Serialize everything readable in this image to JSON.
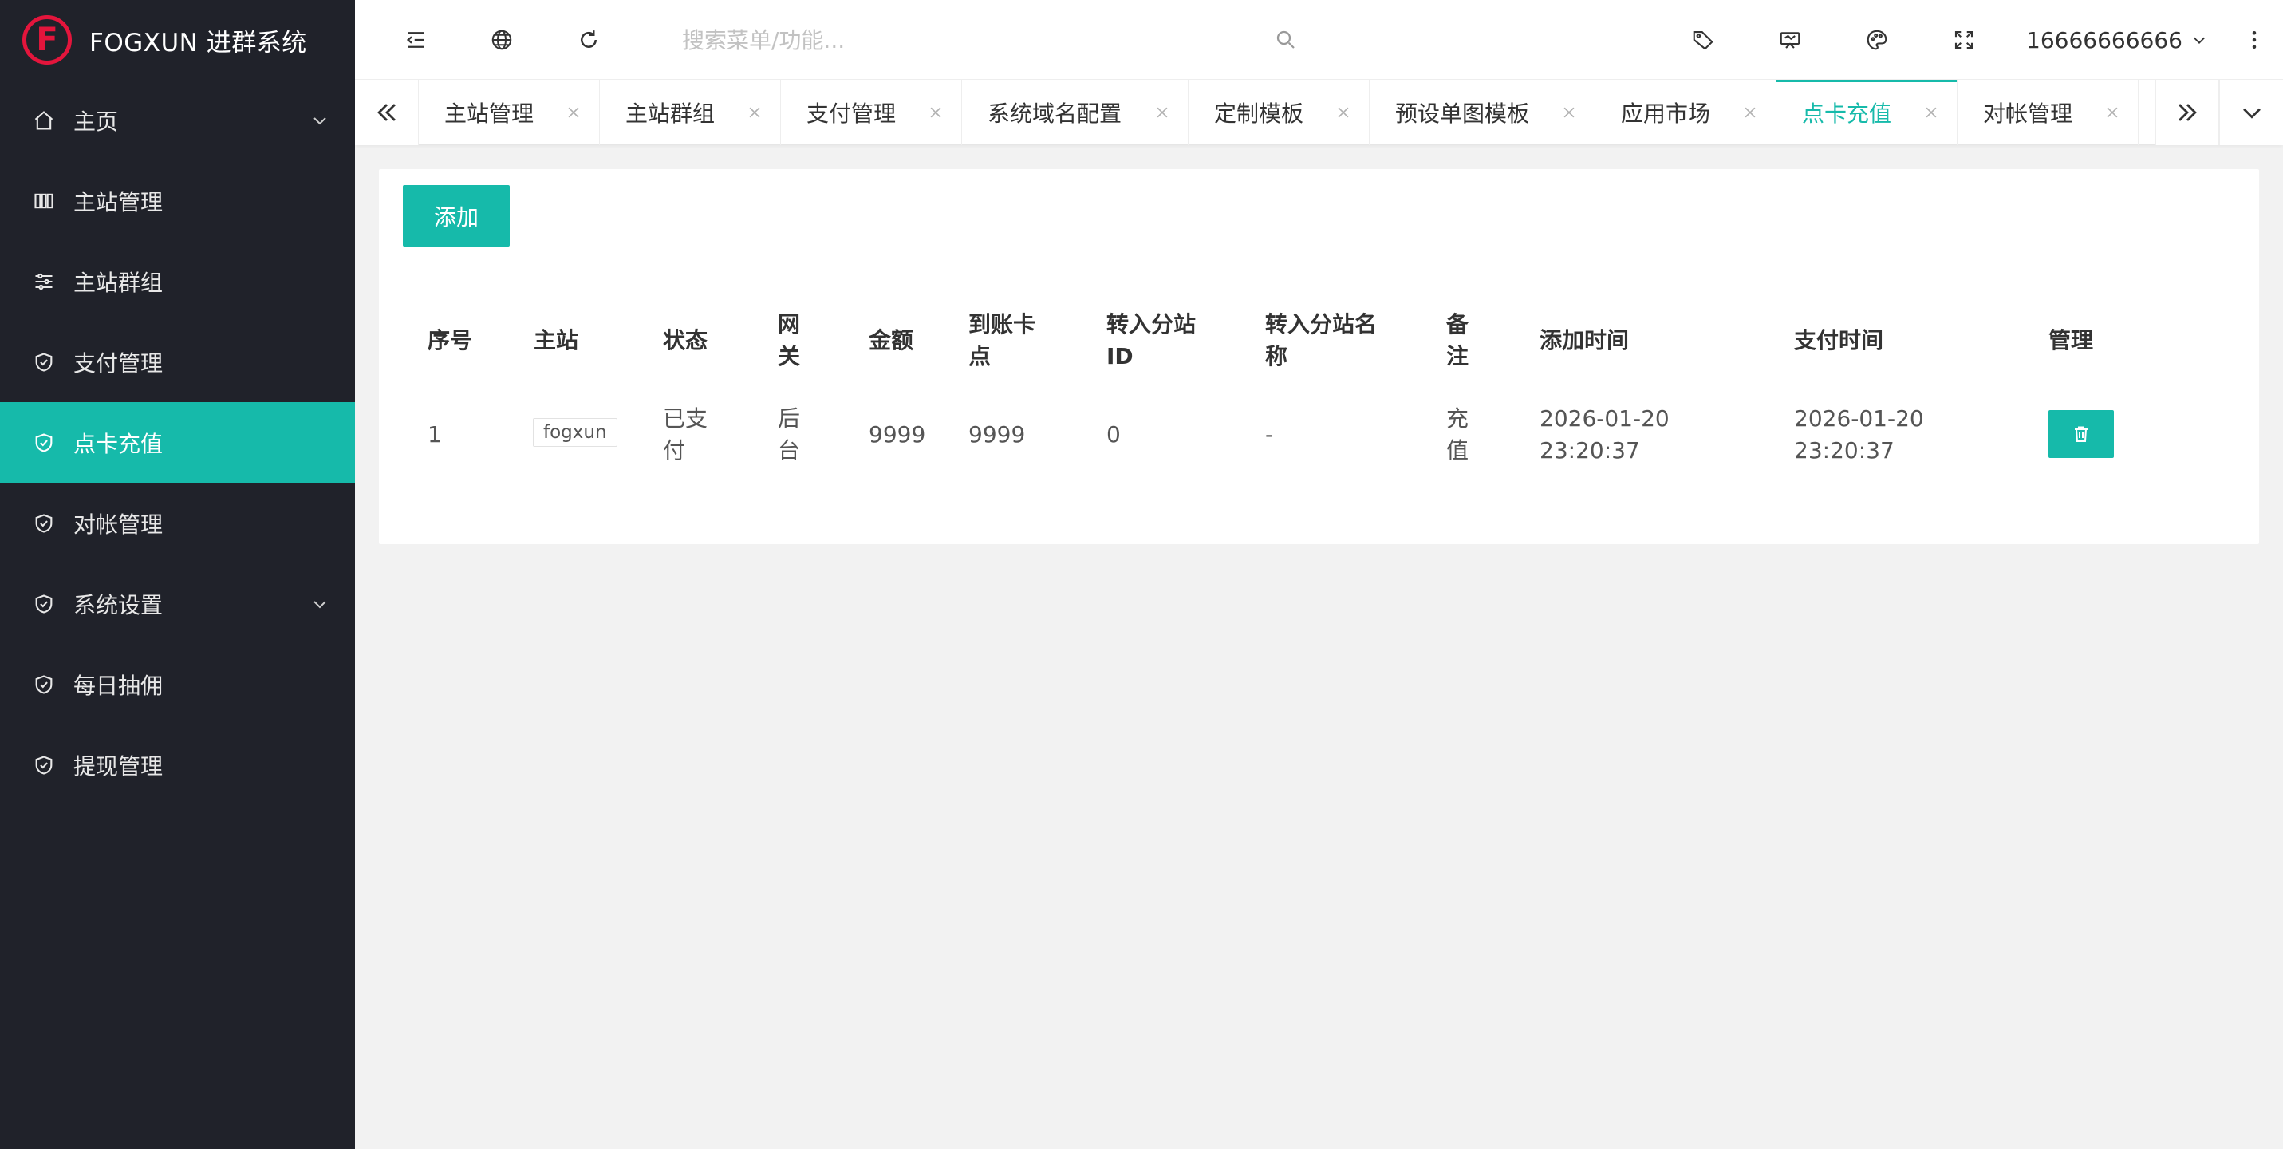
{
  "app": {
    "logo_glyph": "F",
    "logo_text": "FOGXUN 进群系统",
    "accent": "#16baaa",
    "brand_red": "#e4153c"
  },
  "sidebar": {
    "items": [
      {
        "label": "主页",
        "icon": "home-icon",
        "has_chevron": true
      },
      {
        "label": "主站管理",
        "icon": "columns-icon",
        "has_chevron": false
      },
      {
        "label": "主站群组",
        "icon": "sliders-icon",
        "has_chevron": false
      },
      {
        "label": "支付管理",
        "icon": "shield-check-icon",
        "has_chevron": false
      },
      {
        "label": "点卡充值",
        "icon": "shield-check-icon",
        "has_chevron": false,
        "active": true
      },
      {
        "label": "对帐管理",
        "icon": "shield-check-icon",
        "has_chevron": false
      },
      {
        "label": "系统设置",
        "icon": "shield-check-icon",
        "has_chevron": true
      },
      {
        "label": "每日抽佣",
        "icon": "shield-check-icon",
        "has_chevron": false
      },
      {
        "label": "提现管理",
        "icon": "shield-check-icon",
        "has_chevron": false
      }
    ]
  },
  "header": {
    "search_placeholder": "搜索菜单/功能...",
    "user_name": "16666666666"
  },
  "tabs": {
    "items": [
      {
        "label": "主站管理"
      },
      {
        "label": "主站群组"
      },
      {
        "label": "支付管理"
      },
      {
        "label": "系统域名配置"
      },
      {
        "label": "定制模板"
      },
      {
        "label": "预设单图模板"
      },
      {
        "label": "应用市场"
      },
      {
        "label": "点卡充值",
        "active": true
      },
      {
        "label": "对帐管理"
      }
    ]
  },
  "content": {
    "add_label": "添加",
    "columns": [
      "序号",
      "主站",
      "状态",
      "网关",
      "金额",
      "到账卡点",
      "转入分站ID",
      "转入分站名称",
      "备注",
      "添加时间",
      "支付时间",
      "管理"
    ],
    "rows": [
      {
        "index": "1",
        "site": "fogxun",
        "status": "已支付",
        "gateway": "后台",
        "amount": "9999",
        "points": "9999",
        "sub_id": "0",
        "sub_name": "-",
        "remark": "充值",
        "add_time": "2026-01-20 23:20:37",
        "pay_time": "2026-01-20 23:20:37"
      }
    ]
  }
}
